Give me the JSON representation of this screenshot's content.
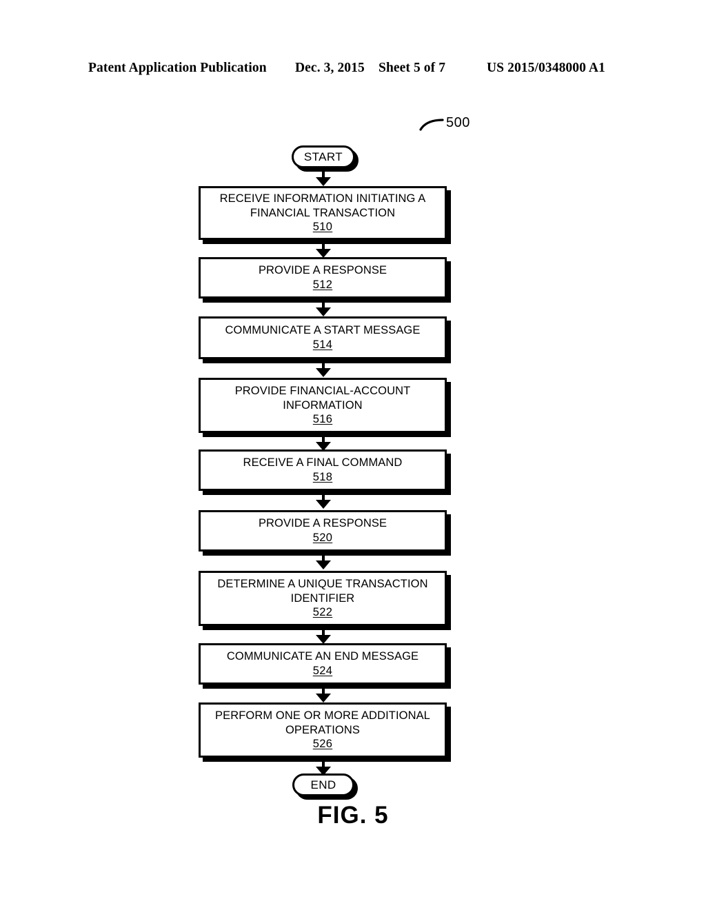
{
  "header": {
    "publication": "Patent Application Publication",
    "date": "Dec. 3, 2015",
    "sheet": "Sheet 5 of 7",
    "patent_number": "US 2015/0348000 A1"
  },
  "figure": {
    "caption": "FIG. 5",
    "reference_numeral": "500",
    "start_label": "START",
    "end_label": "END"
  },
  "chart_data": {
    "type": "diagram",
    "diagram_type": "flowchart",
    "title": "FIG. 5",
    "reference_numeral": "500",
    "orientation": "vertical",
    "nodes": [
      {
        "id": "start",
        "shape": "terminator",
        "label": "START"
      },
      {
        "id": "510",
        "shape": "process",
        "label": "RECEIVE INFORMATION INITIATING A\nFINANCIAL TRANSACTION",
        "number": "510"
      },
      {
        "id": "512",
        "shape": "process",
        "label": "PROVIDE A RESPONSE",
        "number": "512"
      },
      {
        "id": "514",
        "shape": "process",
        "label": "COMMUNICATE A START MESSAGE",
        "number": "514"
      },
      {
        "id": "516",
        "shape": "process",
        "label": "PROVIDE FINANCIAL-ACCOUNT\nINFORMATION",
        "number": "516"
      },
      {
        "id": "518",
        "shape": "process",
        "label": "RECEIVE A FINAL COMMAND",
        "number": "518"
      },
      {
        "id": "520",
        "shape": "process",
        "label": "PROVIDE A RESPONSE",
        "number": "520"
      },
      {
        "id": "522",
        "shape": "process",
        "label": "DETERMINE A UNIQUE TRANSACTION\nIDENTIFIER",
        "number": "522"
      },
      {
        "id": "524",
        "shape": "process",
        "label": "COMMUNICATE AN END MESSAGE",
        "number": "524"
      },
      {
        "id": "526",
        "shape": "process",
        "label": "PERFORM ONE OR MORE ADDITIONAL\nOPERATIONS",
        "number": "526"
      },
      {
        "id": "end",
        "shape": "terminator",
        "label": "END"
      }
    ],
    "edges": [
      {
        "from": "start",
        "to": "510"
      },
      {
        "from": "510",
        "to": "512"
      },
      {
        "from": "512",
        "to": "514"
      },
      {
        "from": "514",
        "to": "516"
      },
      {
        "from": "516",
        "to": "518"
      },
      {
        "from": "518",
        "to": "520"
      },
      {
        "from": "520",
        "to": "522"
      },
      {
        "from": "522",
        "to": "524"
      },
      {
        "from": "524",
        "to": "526"
      },
      {
        "from": "526",
        "to": "end"
      }
    ]
  },
  "steps": {
    "s510": {
      "text": "RECEIVE INFORMATION INITIATING A\nFINANCIAL TRANSACTION",
      "num": "510"
    },
    "s512": {
      "text": "PROVIDE A RESPONSE",
      "num": "512"
    },
    "s514": {
      "text": "COMMUNICATE A START MESSAGE",
      "num": "514"
    },
    "s516": {
      "text": "PROVIDE FINANCIAL-ACCOUNT\nINFORMATION",
      "num": "516"
    },
    "s518": {
      "text": "RECEIVE A FINAL COMMAND",
      "num": "518"
    },
    "s520": {
      "text": "PROVIDE A RESPONSE",
      "num": "520"
    },
    "s522": {
      "text": "DETERMINE A UNIQUE TRANSACTION\nIDENTIFIER",
      "num": "522"
    },
    "s524": {
      "text": "COMMUNICATE AN END MESSAGE",
      "num": "524"
    },
    "s526": {
      "text": "PERFORM ONE OR MORE ADDITIONAL\nOPERATIONS",
      "num": "526"
    }
  }
}
